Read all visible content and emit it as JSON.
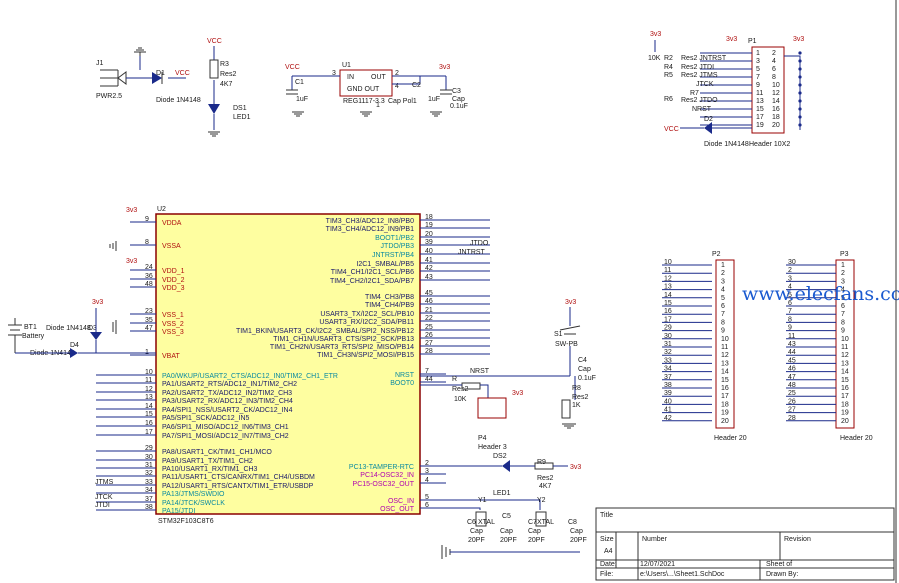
{
  "watermark": "www.elecfans.com",
  "power": {
    "v33": "3v3",
    "vcc": "VCC"
  },
  "top": {
    "j1": "J1",
    "pwr": "PWR2.5",
    "d1": "D1",
    "d1_val": "Diode 1N4148",
    "r3": "R3",
    "res2": "Res2",
    "r3_val": "4K7",
    "ds1": "DS1",
    "led1": "LED1",
    "u1": "U1",
    "in": "IN",
    "out": "OUT",
    "gnd_out": "GND  OUT",
    "reg": "REG1117-3.3",
    "cap_pol1": "Cap Pol1",
    "c1": "C1",
    "c1_val": "1uF",
    "c2": "C2",
    "c2_val": "1uF",
    "c3": "C3",
    "cap": "Cap",
    "c3_val": "0.1uF",
    "pin3": "3",
    "pin2": "2",
    "pin4": "4",
    "pin1": "1"
  },
  "jtag": {
    "p1": "P1",
    "header": "Header 10X2",
    "d2": "D2",
    "d2_val": "Diode 1N4148",
    "r_labels": [
      "10K",
      "R2",
      "R4",
      "R5",
      "Res2"
    ],
    "r6": "R6",
    "r7": "R7",
    "res2": "Res2",
    "sigs": [
      "Res2 JNTRST",
      "Res2 JTDI",
      "Res2 JTMS",
      "JTCK",
      "Res2 JTDO",
      "NRST"
    ],
    "pins_left": [
      "1",
      "3",
      "5",
      "7",
      "9",
      "11",
      "13",
      "15",
      "17",
      "19"
    ],
    "pins_right": [
      "2",
      "4",
      "6",
      "8",
      "10",
      "12",
      "14",
      "16",
      "18",
      "20"
    ]
  },
  "mcu": {
    "u2": "U2",
    "part": "STM32F103C8T6",
    "left_pins": [
      {
        "num": "9",
        "name": "VDDA"
      },
      {
        "num": "8",
        "name": "VSSA"
      },
      {
        "num": "24",
        "name": "VDD_1"
      },
      {
        "num": "36",
        "name": "VDD_2"
      },
      {
        "num": "48",
        "name": "VDD_3"
      },
      {
        "num": "23",
        "name": "VSS_1"
      },
      {
        "num": "35",
        "name": "VSS_2"
      },
      {
        "num": "47",
        "name": "VSS_3"
      },
      {
        "num": "1",
        "name": "VBAT"
      },
      {
        "num": "10",
        "name": "PA0/WKUP/USART2_CTS/ADC12_IN0/TIM2_CH1_ETR"
      },
      {
        "num": "11",
        "name": "PA1/USART2_RTS/ADC12_IN1/TIM2_CH2"
      },
      {
        "num": "12",
        "name": "PA2/USART2_TX/ADC12_IN2/TIM2_CH3"
      },
      {
        "num": "13",
        "name": "PA3/USART2_RX/ADC12_IN3/TIM2_CH4"
      },
      {
        "num": "14",
        "name": "PA4/SPI1_NSS/USART2_CK/ADC12_IN4"
      },
      {
        "num": "15",
        "name": "PA5/SPI1_SCK/ADC12_IN5"
      },
      {
        "num": "16",
        "name": "PA6/SPI1_MISO/ADC12_IN6/TIM3_CH1"
      },
      {
        "num": "17",
        "name": "PA7/SPI1_MOSI/ADC12_IN7/TIM3_CH2"
      },
      {
        "num": "29",
        "name": "PA8/USART1_CK/TIM1_CH1/MCO"
      },
      {
        "num": "30",
        "name": "PA9/USART1_TX/TIM1_CH2"
      },
      {
        "num": "31",
        "name": "PA10/USART1_RX/TIM1_CH3"
      },
      {
        "num": "32",
        "name": "PA11/USART1_CTS/CANRX/TIM1_CH4/USBDM"
      },
      {
        "num": "33",
        "name": "PA12/USART1_RTS/CANTX/TIM1_ETR/USBDP"
      },
      {
        "num": "34",
        "name": "PA13/JTMS/SWDIO"
      },
      {
        "num": "37",
        "name": "PA14/JTCK/SWCLK"
      },
      {
        "num": "38",
        "name": "PA15/JTDI"
      }
    ],
    "left_nets": [
      "JTMS",
      "JTCK",
      "JTDI"
    ],
    "right_pins": [
      {
        "num": "18",
        "name": "TIM3_CH3/ADC12_IN8/PB0"
      },
      {
        "num": "19",
        "name": "TIM3_CH4/ADC12_IN9/PB1"
      },
      {
        "num": "20",
        "name": "BOOT1/PB2"
      },
      {
        "num": "39",
        "name": "JTDO/PB3"
      },
      {
        "num": "40",
        "name": "JNTRST/PB4"
      },
      {
        "num": "41",
        "name": "I2C1_SMBAL/PB5"
      },
      {
        "num": "42",
        "name": "TIM4_CH1/I2C1_SCL/PB6"
      },
      {
        "num": "43",
        "name": "TIM4_CH2/I2C1_SDA/PB7"
      },
      {
        "num": "45",
        "name": "TIM4_CH3/PB8"
      },
      {
        "num": "46",
        "name": "TIM4_CH4/PB9"
      },
      {
        "num": "21",
        "name": "USART3_TX/I2C2_SCL/PB10"
      },
      {
        "num": "22",
        "name": "USART3_RX/I2C2_SDA/PB11"
      },
      {
        "num": "25",
        "name": "TIM1_BKIN/USART3_CK/I2C2_SMBAL/SPI2_NSS/PB12"
      },
      {
        "num": "26",
        "name": "TIM1_CH1N/USART3_CTS/SPI2_SCK/PB13"
      },
      {
        "num": "27",
        "name": "TIM1_CH2N/USART3_RTS/SPI2_MISO/PB14"
      },
      {
        "num": "28",
        "name": "TIM1_CH3N/SPI2_MOSI/PB15"
      },
      {
        "num": "7",
        "name": "NRST"
      },
      {
        "num": "44",
        "name": "BOOT0"
      },
      {
        "num": "2",
        "name": "PC13-TAMPER-RTC"
      },
      {
        "num": "3",
        "name": "PC14-OSC32_IN"
      },
      {
        "num": "4",
        "name": "PC15-OSC32_OUT"
      },
      {
        "num": "5",
        "name": "OSC_IN"
      },
      {
        "num": "6",
        "name": "OSC_OUT"
      }
    ],
    "right_nets": [
      "JTDO",
      "JNTRST"
    ]
  },
  "batt": {
    "bt1": "BT1",
    "battery": "Battery",
    "d3": "D3",
    "d4": "D4",
    "diode": "Diode 1N4148"
  },
  "reset": {
    "s1": "S1",
    "sw": "SW-PB",
    "c4": "C4",
    "cap": "Cap",
    "c4_val": "0.1uF",
    "r8": "R8",
    "res2": "Res2",
    "r8_val": "1K",
    "nrst": "NRST"
  },
  "boot": {
    "r": "R",
    "res2": "Res2",
    "val": "10K",
    "p4": "P4",
    "header": "Header 3"
  },
  "led2": {
    "ds2": "DS2",
    "led1": "LED1",
    "r9": "R9",
    "res2": "Res2",
    "val": "4K7"
  },
  "osc": {
    "y1": "Y1",
    "y2": "Y2",
    "xtal": "XTAL",
    "c5": "C5",
    "c6": "C6",
    "c7": "C7",
    "c8": "C8",
    "cap": "Cap",
    "val": "20PF"
  },
  "headers": {
    "p2": "P2",
    "p3": "P3",
    "label": "Header 20",
    "pins": [
      "1",
      "2",
      "3",
      "4",
      "5",
      "6",
      "7",
      "8",
      "9",
      "10",
      "11",
      "12",
      "13",
      "14",
      "15",
      "16",
      "17",
      "18",
      "19",
      "20"
    ],
    "p2_nets": [
      "10",
      "11",
      "12",
      "13",
      "14",
      "15",
      "16",
      "17",
      "29",
      "30",
      "31",
      "32",
      "33",
      "34",
      "37",
      "38",
      "39",
      "40",
      "41",
      "42"
    ],
    "p3_nets": [
      "30",
      "2",
      "3",
      "4",
      "5",
      "6",
      "7",
      "8",
      "9",
      "11",
      "43",
      "44",
      "45",
      "46",
      "47",
      "48",
      "25",
      "26",
      "27",
      "28"
    ]
  },
  "titleblock": {
    "title_label": "Title",
    "size_label": "Size",
    "size_value": "A4",
    "number_label": "Number",
    "revision_label": "Revision",
    "date_label": "Date:",
    "date_value": "12/07/2021",
    "sheet_label": "Sheet    of",
    "file_label": "File:",
    "file_value": "e:\\Users\\...\\Sheet1.SchDoc",
    "drawn_label": "Drawn By:"
  }
}
